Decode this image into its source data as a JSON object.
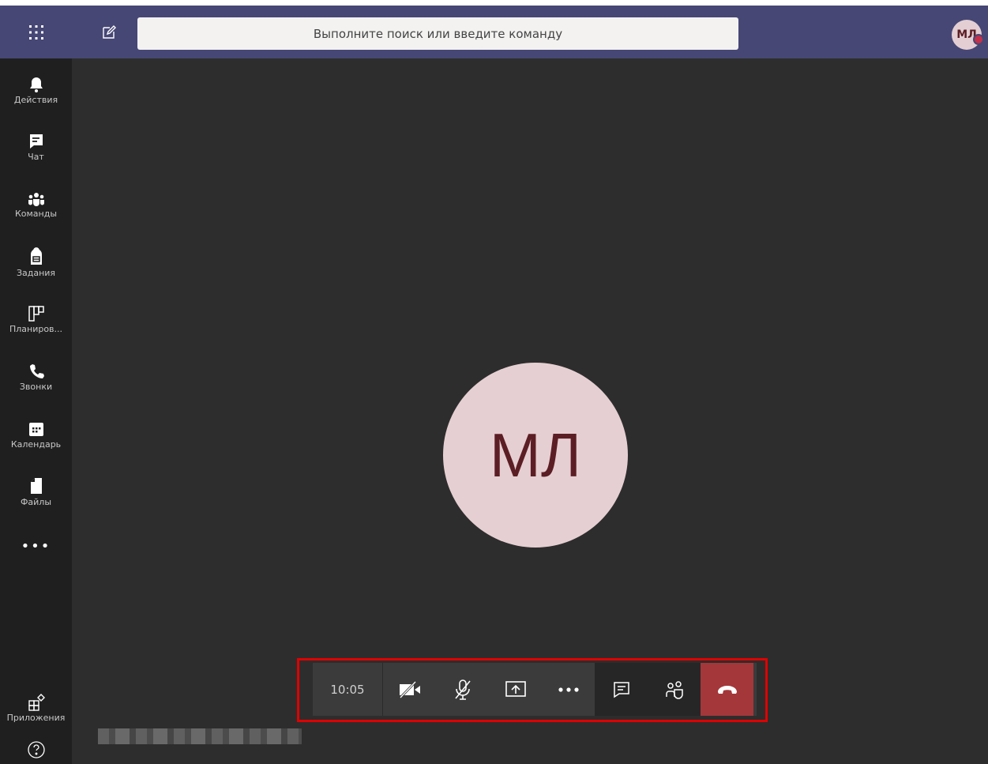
{
  "header": {
    "search_placeholder": "Выполните поиск или введите команду",
    "profile_initials": "МЛ"
  },
  "rail": {
    "items": [
      {
        "label": "Действия",
        "icon": "bell-icon"
      },
      {
        "label": "Чат",
        "icon": "chat-icon"
      },
      {
        "label": "Команды",
        "icon": "teams-icon"
      },
      {
        "label": "Задания",
        "icon": "backpack-icon"
      },
      {
        "label": "Планиров...",
        "icon": "planner-icon"
      },
      {
        "label": "Звонки",
        "icon": "phone-icon"
      },
      {
        "label": "Календарь",
        "icon": "calendar-icon"
      },
      {
        "label": "Файлы",
        "icon": "file-icon"
      }
    ],
    "more": "•••",
    "apps_label": "Приложения",
    "help_icon": "help-icon"
  },
  "call": {
    "participant_initials": "МЛ",
    "duration": "10:05",
    "colors": {
      "hangup": "#a4373a",
      "avatar_bg": "#e6cfd2",
      "header": "#464775"
    }
  }
}
